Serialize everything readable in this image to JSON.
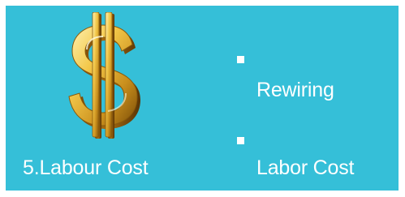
{
  "slide": {
    "background_color": "#35bfd8",
    "image": {
      "icon": "gold-dollar-sign-icon"
    },
    "caption": "5.Labour Cost",
    "bullets": [
      {
        "text": "Rewiring"
      },
      {
        "text": "Labor Cost"
      }
    ]
  },
  "colors": {
    "text": "#ffffff",
    "gold_light": "#fbe38a",
    "gold_mid": "#d8a428",
    "gold_dark": "#8a5a0b"
  }
}
